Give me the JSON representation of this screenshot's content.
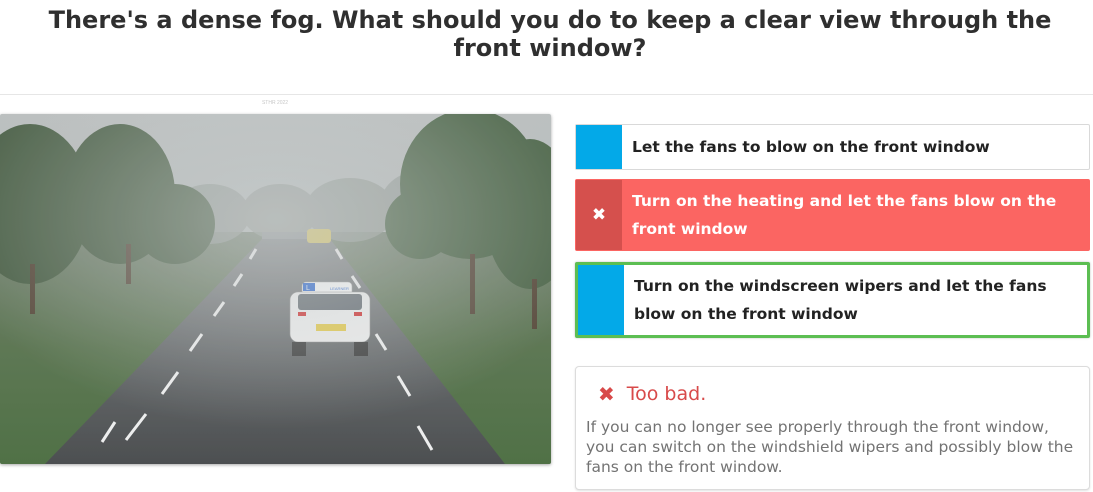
{
  "question": {
    "title": "There's a dense fog. What should you do to keep a clear view through the front window?"
  },
  "scene": {
    "caption": "STHR 2022",
    "plate_front": "L",
    "roof_sign": "LEARNER"
  },
  "answers": [
    {
      "marker": "",
      "label": "Let the fans to blow on the front window",
      "state": "neutral"
    },
    {
      "marker": "✖",
      "label": "Turn on the heating and let the fans blow on the front window",
      "state": "selected-wrong"
    },
    {
      "marker": "",
      "label": "Turn on the windscreen wipers and let the fans blow on the front window",
      "state": "correct"
    }
  ],
  "feedback": {
    "icon": "✖",
    "title": "Too bad.",
    "body": "If you can no longer see properly through the front window, you can switch on the windshield wipers and possibly blow the fans on the front window."
  },
  "colors": {
    "accent_blue": "#03a9e8",
    "wrong_red": "#fb6562",
    "wrong_red_dark": "#d5504d",
    "correct_green": "#5cbe52",
    "feedback_red": "#d84a4a"
  }
}
